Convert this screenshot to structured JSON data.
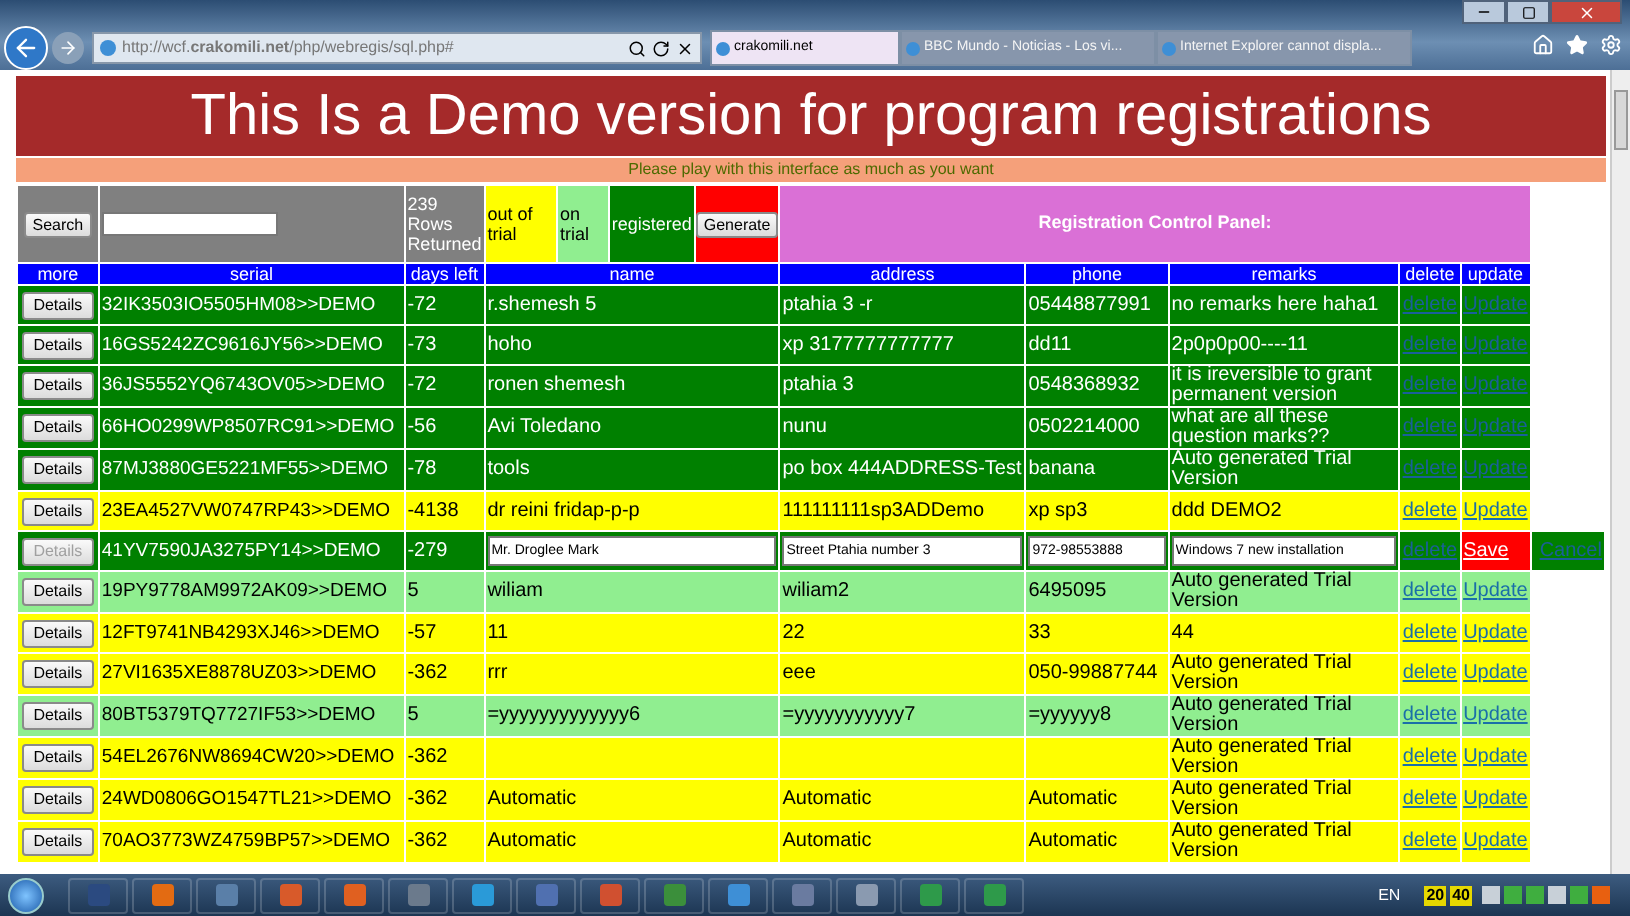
{
  "browser": {
    "address": "http://wcf.**crakomili.net**/php/webregis/sql.php#",
    "tabs": [
      {
        "label": "crakomili.net",
        "selected": true
      },
      {
        "label": "BBC Mundo - Noticias - Los vi...",
        "selected": false
      },
      {
        "label": "Internet Explorer cannot displa...",
        "selected": false
      }
    ]
  },
  "page": {
    "title": "This Is a Demo version for program registrations",
    "subtitle": "Please play with this interface as much as you want",
    "controls": {
      "search_button": "Search",
      "rows_returned": "239 Rows Returned",
      "legend": [
        {
          "label": "out of trial",
          "kind": "expired"
        },
        {
          "label": "on trial",
          "kind": "trial"
        },
        {
          "label": "registered",
          "kind": "registered"
        }
      ],
      "generate_button": "Generate",
      "panel_title": "Registration Control Panel:"
    },
    "table": {
      "columns": [
        "more",
        "serial",
        "days left",
        "name",
        "address",
        "phone",
        "remarks",
        "delete",
        "update"
      ],
      "rows": [
        {
          "kind": "registered",
          "editing": false,
          "details": "Details",
          "serial": "32IK3503IO5505HM08>>DEMO",
          "days_left": "-72",
          "name": "r.shemesh 5",
          "address": "ptahia 3 -r",
          "phone": "05448877991",
          "remarks": "no remarks here haha1",
          "delete": "delete",
          "update": "Update"
        },
        {
          "kind": "registered",
          "editing": false,
          "details": "Details",
          "serial": "16GS5242ZC9616JY56>>DEMO",
          "days_left": "-73",
          "name": "hoho",
          "address": "xp 3177777777777",
          "phone": "dd11",
          "remarks": "2p0p0p00----11",
          "delete": "delete",
          "update": "Update"
        },
        {
          "kind": "registered",
          "editing": false,
          "details": "Details",
          "serial": "36JS5552YQ6743OV05>>DEMO",
          "days_left": "-72",
          "name": "ronen shemesh",
          "address": "ptahia 3",
          "phone": "0548368932",
          "remarks": "it is ireversible to grant permanent version",
          "delete": "delete",
          "update": "Update"
        },
        {
          "kind": "registered",
          "editing": false,
          "details": "Details",
          "serial": "66HO0299WP8507RC91>>DEMO",
          "days_left": "-56",
          "name": "Avi Toledano",
          "address": "nunu",
          "phone": "0502214000",
          "remarks": "what are all these question marks??",
          "delete": "delete",
          "update": "Update"
        },
        {
          "kind": "registered",
          "editing": false,
          "details": "Details",
          "serial": "87MJ3880GE5221MF55>>DEMO",
          "days_left": "-78",
          "name": "tools",
          "address": "po box 444ADDRESS-Test",
          "phone": "banana",
          "remarks": "Auto generated Trial Version",
          "delete": "delete",
          "update": "Update"
        },
        {
          "kind": "expired",
          "editing": false,
          "details": "Details",
          "serial": "23EA4527VW0747RP43>>DEMO",
          "days_left": "-4138",
          "name": "dr reini fridap-p-p",
          "address": "111111111sp3ADDemo",
          "phone": "xp sp3",
          "remarks": "ddd DEMO2",
          "delete": "delete",
          "update": "Update"
        },
        {
          "kind": "registered",
          "editing": true,
          "details": "Details",
          "serial": "41YV7590JA3275PY14>>DEMO",
          "days_left": "-279",
          "name": "Mr. Droglee Mark",
          "address": "Street Ptahia number 3",
          "phone": "972-98553888",
          "remarks": "Windows 7 new installation",
          "delete": "delete",
          "update": "Save",
          "cancel": "Cancel"
        },
        {
          "kind": "trial",
          "editing": false,
          "details": "Details",
          "serial": "19PY9778AM9972AK09>>DEMO",
          "days_left": "5",
          "name": "wiliam",
          "address": "wiliam2",
          "phone": "6495095",
          "remarks": "Auto generated Trial Version",
          "delete": "delete",
          "update": "Update"
        },
        {
          "kind": "expired",
          "editing": false,
          "details": "Details",
          "serial": "12FT9741NB4293XJ46>>DEMO",
          "days_left": "-57",
          "name": "11",
          "address": "22",
          "phone": "33",
          "remarks": "44",
          "delete": "delete",
          "update": "Update"
        },
        {
          "kind": "expired",
          "editing": false,
          "details": "Details",
          "serial": "27VI1635XE8878UZ03>>DEMO",
          "days_left": "-362",
          "name": "rrr",
          "address": "eee",
          "phone": "050-99887744",
          "remarks": "Auto generated Trial Version",
          "delete": "delete",
          "update": "Update"
        },
        {
          "kind": "trial",
          "editing": false,
          "details": "Details",
          "serial": "80BT5379TQ7727IF53>>DEMO",
          "days_left": "5",
          "name": "=yyyyyyyyyyyyy6",
          "address": "=yyyyyyyyyyy7",
          "phone": "=yyyyyy8",
          "remarks": "Auto generated Trial Version",
          "delete": "delete",
          "update": "Update"
        },
        {
          "kind": "expired",
          "editing": false,
          "details": "Details",
          "serial": "54EL2676NW8694CW20>>DEMO",
          "days_left": "-362",
          "remarks": "Auto generated Trial Version",
          "delete": "delete",
          "update": "Update"
        },
        {
          "kind": "expired",
          "editing": false,
          "details": "Details",
          "serial": "24WD0806GO1547TL21>>DEMO",
          "days_left": "-362",
          "name": "Automatic",
          "address": "Automatic",
          "phone": "Automatic",
          "remarks": "Auto generated Trial Version",
          "delete": "delete",
          "update": "Update"
        },
        {
          "kind": "expired",
          "editing": false,
          "details": "Details",
          "serial": "70AO3773WZ4759BP57>>DEMO",
          "days_left": "-362",
          "name": "Automatic",
          "address": "Automatic",
          "phone": "Automatic",
          "remarks": "Auto generated Trial Version",
          "delete": "delete",
          "update": "Update"
        }
      ]
    }
  },
  "taskbar": {
    "language": "EN",
    "badges": [
      "20",
      "40"
    ]
  }
}
